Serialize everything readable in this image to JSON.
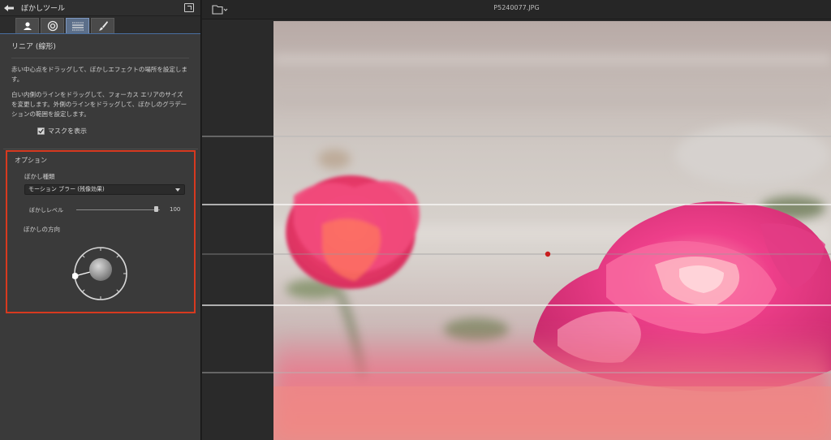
{
  "panel": {
    "title": "ぼかしツール",
    "tabs": [
      "portrait-icon",
      "radial-icon",
      "linear-icon",
      "brush-icon"
    ],
    "active_tab": 2,
    "section_title": "リニア (線形)",
    "description_1": "赤い中心点をドラッグして、ぼかしエフェクトの場所を設定します。",
    "description_2": "白い内側のラインをドラッグして、フォーカス エリアのサイズを変更します。外側のラインをドラッグして、ぼかしのグラデーションの範囲を設定します。",
    "mask_label": "マスクを表示",
    "mask_checked": true
  },
  "options": {
    "title": "オプション",
    "blur_type_label": "ぼかし種類",
    "blur_type_value": "モーション ブラー (残像効果)",
    "blur_level_label": "ぼかしレベル",
    "blur_level_value": "100",
    "direction_label": "ぼかしの方向"
  },
  "viewer": {
    "filename": "P5240077.JPG"
  },
  "colors": {
    "highlight": "#d7391f",
    "rose": "#e8407a",
    "center_point": "#c81e1e"
  }
}
